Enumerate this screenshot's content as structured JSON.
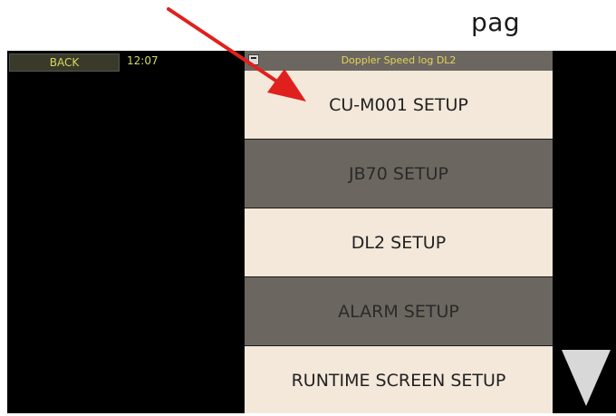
{
  "page_fragment": "pag",
  "topbar": {
    "back_label": "BACK",
    "time": "12:07",
    "title": "Doppler Speed log DL2"
  },
  "menu": {
    "items": [
      {
        "label": "CU-M001 SETUP",
        "style": "light"
      },
      {
        "label": "JB70 SETUP",
        "style": "dark"
      },
      {
        "label": "DL2 SETUP",
        "style": "light"
      },
      {
        "label": "ALARM SETUP",
        "style": "dark"
      },
      {
        "label": "RUNTIME SCREEN SETUP",
        "style": "light"
      }
    ]
  },
  "icons": {
    "title_icon": "device-icon",
    "scroll": "triangle-down-icon"
  },
  "colors": {
    "accent_text": "#d8d860",
    "title_text": "#e4d45a",
    "light_row": "#f4e8da",
    "dark_row": "#6b6760",
    "annotation_arrow": "#e0201e"
  }
}
